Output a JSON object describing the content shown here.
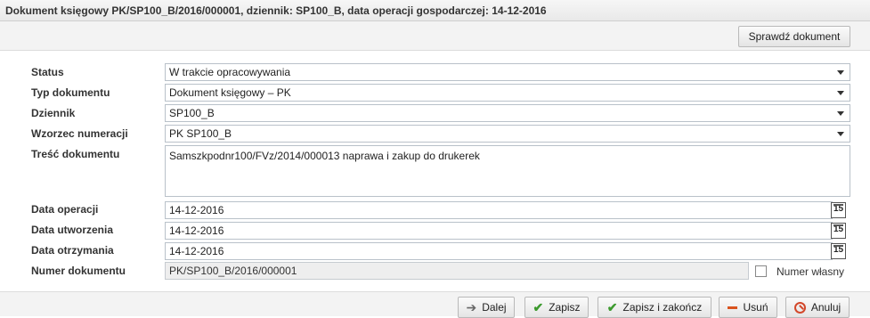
{
  "window": {
    "title": "Dokument księgowy PK/SP100_B/2016/000001, dziennik: SP100_B, data operacji gospodarczej: 14-12-2016"
  },
  "toolbar": {
    "check_label": "Sprawdź dokument"
  },
  "form": {
    "status": {
      "label": "Status",
      "value": "W trakcie opracowywania"
    },
    "doc_type": {
      "label": "Typ dokumentu",
      "value": "Dokument księgowy – PK"
    },
    "journal": {
      "label": "Dziennik",
      "value": "SP100_B"
    },
    "numbering": {
      "label": "Wzorzec numeracji",
      "value": "PK SP100_B"
    },
    "content": {
      "label": "Treść dokumentu",
      "value": "Samszkpodnr100/FVz/2014/000013 naprawa i zakup do drukerek"
    },
    "op_date": {
      "label": "Data operacji",
      "value": "14-12-2016"
    },
    "created_date": {
      "label": "Data utworzenia",
      "value": "14-12-2016"
    },
    "received_date": {
      "label": "Data otrzymania",
      "value": "14-12-2016"
    },
    "doc_number": {
      "label": "Numer dokumentu",
      "value": "PK/SP100_B/2016/000001",
      "own_number_label": "Numer własny",
      "own_number_checked": false
    },
    "calendar_day": "15"
  },
  "footer": {
    "next_label": "Dalej",
    "save_label": "Zapisz",
    "save_close_label": "Zapisz i zakończ",
    "delete_label": "Usuń",
    "cancel_label": "Anuluj"
  }
}
